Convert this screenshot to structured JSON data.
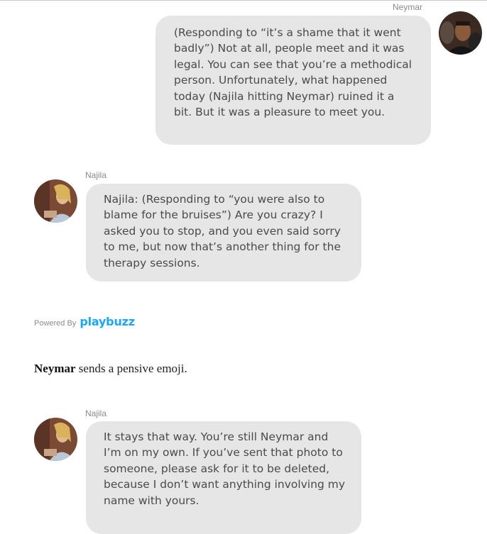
{
  "messages": [
    {
      "sender": "Neymar",
      "text": "(Responding to “it’s a shame that it went badly”) Not at all, people meet and it was legal. You can see that you’re a methodical person. Unfortunately, what happened today (Najila hitting Neymar) ruined it a bit. But it was a pleasure to meet you."
    },
    {
      "sender": "Najila",
      "text": "Najila: (Responding to “you were also to blame for the bruises”) Are you crazy? I asked you to stop, and you even said sorry to me, but now that’s another thing for the therapy sessions."
    },
    {
      "sender": "Najila",
      "text": "It stays that way. You’re still Neymar and I’m on my own. If you’ve sent that photo to someone, please ask for it to be deleted, because I don’t want anything involving my name with yours."
    }
  ],
  "powered_by": {
    "label": "Powered By",
    "brand": "playbuzz"
  },
  "narration": {
    "name": "Neymar",
    "rest": " sends a pensive emoji."
  },
  "colors": {
    "bubble": "#e6e6e6",
    "brand": "#1aa5ff",
    "text": "#4a4a4a"
  }
}
